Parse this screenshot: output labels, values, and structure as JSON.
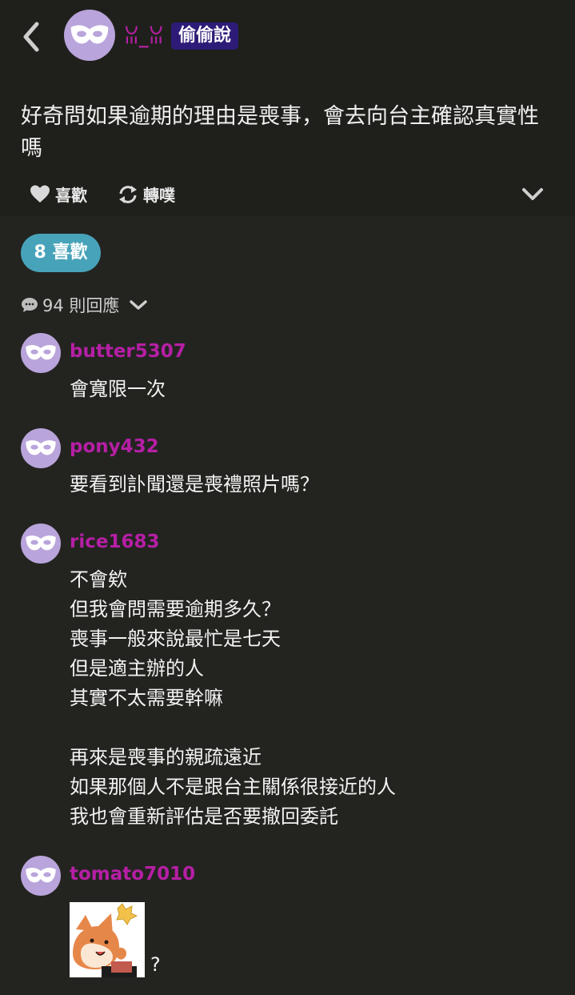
{
  "post": {
    "author": "ꈍ_ꈍ",
    "badge": "偷偷說",
    "body": "好奇問如果逾期的理由是喪事，會去向台主確認真實性嗎",
    "actions": {
      "like_label": "喜歡",
      "repost_label": "轉噗"
    }
  },
  "stats": {
    "likes_label": "8 喜歡",
    "replies_label": "94 則回應"
  },
  "comments": [
    {
      "username": "butter5307",
      "text": "會寬限一次"
    },
    {
      "username": "pony432",
      "text": "要看到訃聞還是喪禮照片嗎？"
    },
    {
      "username": "rice1683",
      "text": "不會欸\n但我會問需要逾期多久？\n喪事一般來說最忙是七天\n但是適主辦的人\n其實不太需要幹嘛\n\n再來是喪事的親疏遠近\n如果那個人不是跟台主關係很接近的人\n我也會重新評估是否要撤回委託"
    },
    {
      "username": "tomato7010",
      "text": "?"
    }
  ],
  "colors": {
    "background": "#232420",
    "header_bg": "#1f201c",
    "username": "#b61fa5",
    "badge_bg": "#2e1b78",
    "likes_pill": "#47a3b9",
    "avatar": "#b9a4db"
  }
}
